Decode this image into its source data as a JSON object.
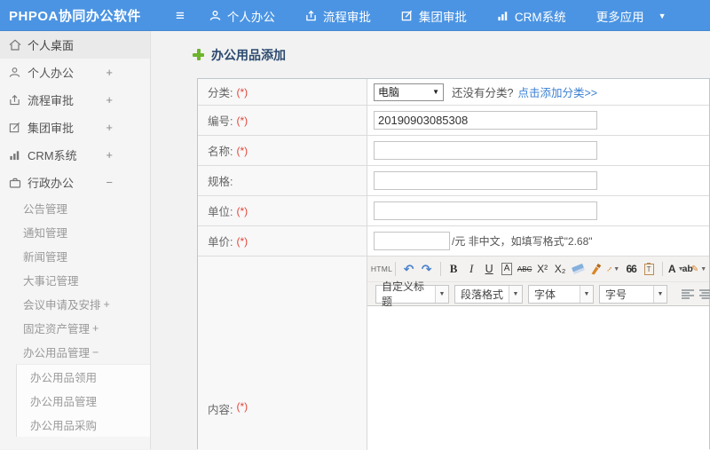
{
  "header": {
    "logo": "PHPOA协同办公软件",
    "nav": [
      {
        "label": "个人办公"
      },
      {
        "label": "流程审批"
      },
      {
        "label": "集团审批"
      },
      {
        "label": "CRM系统"
      },
      {
        "label": "更多应用"
      }
    ]
  },
  "sidebar": {
    "items": [
      {
        "label": "个人桌面",
        "expand": ""
      },
      {
        "label": "个人办公",
        "expand": "+"
      },
      {
        "label": "流程审批",
        "expand": "+"
      },
      {
        "label": "集团审批",
        "expand": "+"
      },
      {
        "label": "CRM系统",
        "expand": "+"
      },
      {
        "label": "行政办公",
        "expand": "−"
      }
    ],
    "sub_items": [
      {
        "label": "公告管理",
        "expand": ""
      },
      {
        "label": "通知管理",
        "expand": ""
      },
      {
        "label": "新闻管理",
        "expand": ""
      },
      {
        "label": "大事记管理",
        "expand": ""
      },
      {
        "label": "会议申请及安排",
        "expand": "+"
      },
      {
        "label": "固定资产管理",
        "expand": "+"
      },
      {
        "label": "办公用品管理",
        "expand": "−"
      }
    ],
    "third_items": [
      {
        "label": "办公用品领用"
      },
      {
        "label": "办公用品管理"
      },
      {
        "label": "办公用品采购"
      }
    ]
  },
  "page": {
    "title": "办公用品添加"
  },
  "form": {
    "labels": [
      {
        "text": "分类:",
        "req": "(*)"
      },
      {
        "text": "编号:",
        "req": "(*)"
      },
      {
        "text": "名称:",
        "req": "(*)"
      },
      {
        "text": "规格:",
        "req": ""
      },
      {
        "text": "单位:",
        "req": "(*)"
      },
      {
        "text": "单价:",
        "req": "(*)"
      },
      {
        "text": "内容:",
        "req": "(*)"
      }
    ],
    "category": {
      "value": "电脑",
      "hint": "还没有分类?",
      "link": "点击添加分类>>"
    },
    "number": {
      "value": "20190903085308"
    },
    "price": {
      "suffix": "/元 非中文，如填写格式\"2.68\""
    }
  },
  "editor": {
    "source": "HTML",
    "undo": "↶",
    "redo": "↷",
    "bold": "B",
    "italic": "I",
    "underline": "U",
    "font_border": "A",
    "strike": "ABC",
    "superscript": "X²",
    "subscript": "X₂",
    "quote": "66",
    "paste": "T",
    "font_color": "A",
    "highlight": "ab",
    "highlight_pen": "✎",
    "title_dd": "自定义标题",
    "para_dd": "段落格式",
    "font_dd": "字体",
    "size_dd": "字号"
  },
  "icons": {
    "hamburger": "≡",
    "caret_down": "▼",
    "dd_caret": "▼",
    "expand_plus": "+",
    "collapse_minus": "−"
  },
  "colors": {
    "header_bg": "#4b94e3",
    "link": "#3a7fd2",
    "required": "#e2463a",
    "title": "#2b4a6f",
    "plus_green": "#6cb52d"
  }
}
